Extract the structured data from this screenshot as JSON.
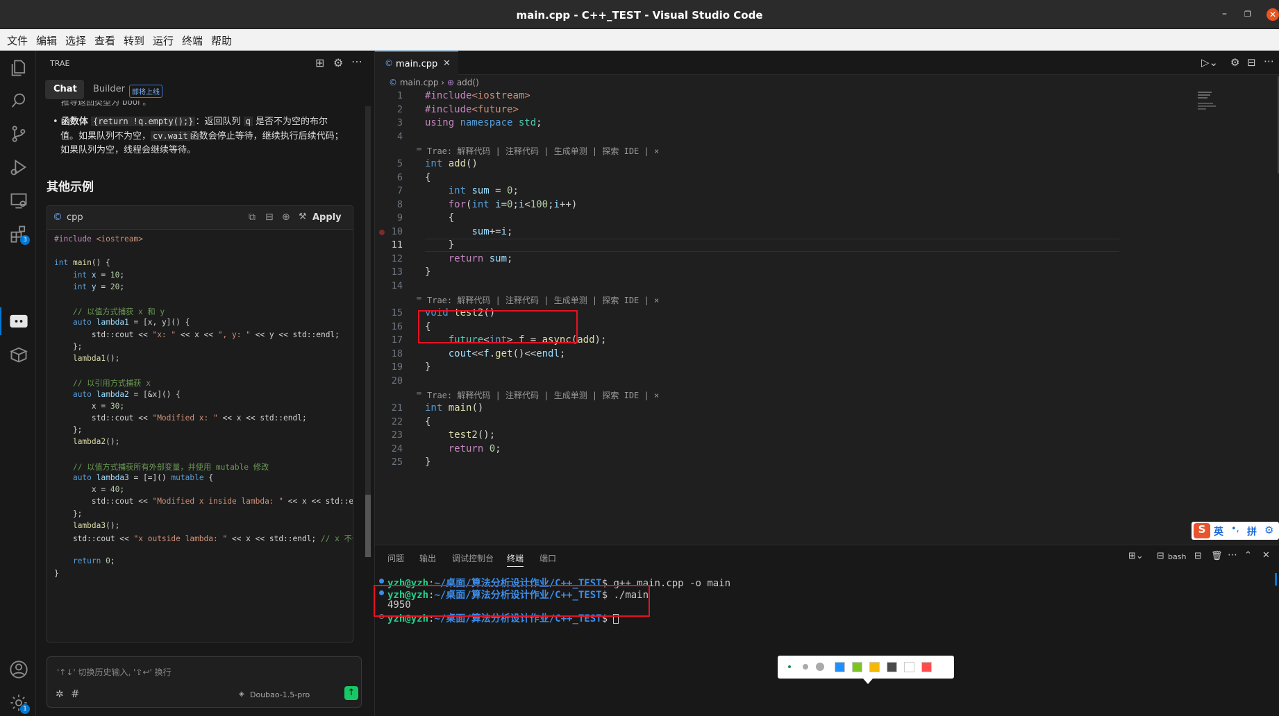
{
  "window": {
    "title": "main.cpp - C++_TEST - Visual Studio Code",
    "minimize": "–",
    "restore": "❐",
    "close": "✕"
  },
  "menu": [
    "文件",
    "编辑",
    "选择",
    "查看",
    "转到",
    "运行",
    "终端",
    "帮助"
  ],
  "activity": [
    {
      "icon": "files-icon"
    },
    {
      "icon": "search-icon"
    },
    {
      "icon": "source-control-icon"
    },
    {
      "icon": "run-debug-icon"
    },
    {
      "icon": "remote-explorer-icon"
    },
    {
      "icon": "extensions-icon",
      "badge": "3"
    },
    {
      "icon": "trae-chat-icon"
    },
    {
      "icon": "package-icon"
    },
    {
      "icon": "account-icon"
    },
    {
      "icon": "settings-gear-icon",
      "badge": "1"
    }
  ],
  "sidebar": {
    "title": "TRAE",
    "tab_chat": "Chat",
    "tab_builder": "Builder",
    "builder_badge": "即将上线",
    "cut_line": "推导返回类型为 bool 。",
    "bullet_label": "函数体",
    "bullet_code": "{return !q.empty();}",
    "bullet_text_a": "：返回队列",
    "bullet_q": "q",
    "bullet_text_b": "是否不为空的布尔",
    "bullet_line2a": "值。如果队列不为空，",
    "bullet_cvwait": "cv.wait",
    "bullet_line2b": "函数会停止等待，继续执行后续代码；",
    "bullet_line3": "如果队列为空，线程会继续等待。",
    "heading": "其他示例",
    "code_lang": "cpp",
    "apply": "Apply",
    "input_placeholder": "'↑↓' 切换历史输入, '⇧↩' 换行",
    "model": "Doubao-1.5-pro"
  },
  "sidebar_code": [
    [
      [
        "pp",
        "#include "
      ],
      [
        "inc",
        "<iostream>"
      ]
    ],
    [],
    [
      [
        "kw",
        "int "
      ],
      [
        "fn",
        "main"
      ],
      [
        "",
        "() {"
      ]
    ],
    [
      [
        "",
        "    "
      ],
      [
        "kw",
        "int "
      ],
      [
        "id",
        "x"
      ],
      [
        "",
        " = "
      ],
      [
        "num",
        "10"
      ],
      [
        "",
        ";"
      ]
    ],
    [
      [
        "",
        "    "
      ],
      [
        "kw",
        "int "
      ],
      [
        "id",
        "y"
      ],
      [
        "",
        " = "
      ],
      [
        "num",
        "20"
      ],
      [
        "",
        ";"
      ]
    ],
    [],
    [
      [
        "",
        "    "
      ],
      [
        "cmt",
        "// 以值方式捕获 x 和 y"
      ]
    ],
    [
      [
        "",
        "    "
      ],
      [
        "kw",
        "auto "
      ],
      [
        "id",
        "lambda1"
      ],
      [
        "",
        " = [x, y]() {"
      ]
    ],
    [
      [
        "",
        "        std::cout << "
      ],
      [
        "str",
        "\"x: \""
      ],
      [
        "",
        " << x << "
      ],
      [
        "str",
        "\", y: \""
      ],
      [
        "",
        " << y << std::endl;"
      ]
    ],
    [
      [
        "",
        "    };"
      ]
    ],
    [
      [
        "",
        "    "
      ],
      [
        "fn",
        "lambda1"
      ],
      [
        "",
        "();"
      ]
    ],
    [],
    [
      [
        "",
        "    "
      ],
      [
        "cmt",
        "// 以引用方式捕获 x"
      ]
    ],
    [
      [
        "",
        "    "
      ],
      [
        "kw",
        "auto "
      ],
      [
        "id",
        "lambda2"
      ],
      [
        "",
        " = [&x]() {"
      ]
    ],
    [
      [
        "",
        "        x = "
      ],
      [
        "num",
        "30"
      ],
      [
        "",
        ";"
      ]
    ],
    [
      [
        "",
        "        std::cout << "
      ],
      [
        "str",
        "\"Modified x: \""
      ],
      [
        "",
        " << x << std::endl;"
      ]
    ],
    [
      [
        "",
        "    };"
      ]
    ],
    [
      [
        "",
        "    "
      ],
      [
        "fn",
        "lambda2"
      ],
      [
        "",
        "();"
      ]
    ],
    [],
    [
      [
        "",
        "    "
      ],
      [
        "cmt",
        "// 以值方式捕获所有外部变量，并使用 mutable 修改"
      ]
    ],
    [
      [
        "",
        "    "
      ],
      [
        "kw",
        "auto "
      ],
      [
        "id",
        "lambda3"
      ],
      [
        "",
        " = [=]() "
      ],
      [
        "kw",
        "mutable"
      ],
      [
        "",
        " {"
      ]
    ],
    [
      [
        "",
        "        x = "
      ],
      [
        "num",
        "40"
      ],
      [
        "",
        ";"
      ]
    ],
    [
      [
        "",
        "        std::cout << "
      ],
      [
        "str",
        "\"Modified x inside lambda: \""
      ],
      [
        "",
        " << x << std::endl;"
      ]
    ],
    [
      [
        "",
        "    };"
      ]
    ],
    [
      [
        "",
        "    "
      ],
      [
        "fn",
        "lambda3"
      ],
      [
        "",
        "();"
      ]
    ],
    [
      [
        "",
        "    std::cout << "
      ],
      [
        "str",
        "\"x outside lambda: \""
      ],
      [
        "",
        " << x << std::endl; "
      ],
      [
        "cmt",
        "// x 不会"
      ]
    ],
    [],
    [
      [
        "",
        "    "
      ],
      [
        "kw",
        "return "
      ],
      [
        "num",
        "0"
      ],
      [
        "",
        ";"
      ]
    ],
    [
      [
        "",
        "}"
      ]
    ]
  ],
  "editor": {
    "tab": "main.cpp",
    "breadcrumb_file": "main.cpp",
    "breadcrumb_symbol": "add()",
    "lens": "Trae: 解释代码 | 注释代码 | 生成单测 | 探索 IDE | ×",
    "lines": [
      {
        "n": "1",
        "t": [
          [
            "pp",
            "#include"
          ],
          [
            "inc",
            "<iostream>"
          ]
        ]
      },
      {
        "n": "2",
        "t": [
          [
            "pp",
            "#include"
          ],
          [
            "inc",
            "<future>"
          ]
        ]
      },
      {
        "n": "3",
        "t": [
          [
            "pp",
            "using "
          ],
          [
            "kw",
            "namespace "
          ],
          [
            "ty",
            "std"
          ],
          [
            "",
            ";"
          ]
        ]
      },
      {
        "n": "4",
        "t": []
      },
      {
        "n": "5",
        "lens": true,
        "t": [
          [
            "kw",
            "int "
          ],
          [
            "fn",
            "add"
          ],
          [
            "",
            "()"
          ]
        ]
      },
      {
        "n": "6",
        "t": [
          [
            "",
            "{"
          ]
        ]
      },
      {
        "n": "7",
        "t": [
          [
            "",
            "    "
          ],
          [
            "kw",
            "int "
          ],
          [
            "id",
            "sum"
          ],
          [
            "",
            " = "
          ],
          [
            "num",
            "0"
          ],
          [
            "",
            ";"
          ]
        ]
      },
      {
        "n": "8",
        "t": [
          [
            "",
            "    "
          ],
          [
            "pp",
            "for"
          ],
          [
            "",
            "("
          ],
          [
            "kw",
            "int "
          ],
          [
            "id",
            "i"
          ],
          [
            "",
            "="
          ],
          [
            "num",
            "0"
          ],
          [
            "",
            ";"
          ],
          [
            "id",
            "i"
          ],
          [
            "",
            "<"
          ],
          [
            "num",
            "100"
          ],
          [
            "",
            ";"
          ],
          [
            "id",
            "i"
          ],
          [
            "",
            "++)"
          ]
        ]
      },
      {
        "n": "9",
        "t": [
          [
            "",
            "    {"
          ]
        ]
      },
      {
        "n": "10",
        "bp": true,
        "t": [
          [
            "",
            "        "
          ],
          [
            "id",
            "sum"
          ],
          [
            "",
            "+="
          ],
          [
            "id",
            "i"
          ],
          [
            "",
            ";"
          ]
        ]
      },
      {
        "n": "11",
        "cur": true,
        "t": [
          [
            "",
            "    }"
          ]
        ]
      },
      {
        "n": "12",
        "t": [
          [
            "",
            "    "
          ],
          [
            "pp",
            "return "
          ],
          [
            "id",
            "sum"
          ],
          [
            "",
            ";"
          ]
        ]
      },
      {
        "n": "13",
        "t": [
          [
            "",
            "}"
          ]
        ]
      },
      {
        "n": "14",
        "t": []
      },
      {
        "n": "15",
        "lens": true,
        "t": [
          [
            "kw",
            "void "
          ],
          [
            "fn",
            "test2"
          ],
          [
            "",
            "()"
          ]
        ]
      },
      {
        "n": "16",
        "t": [
          [
            "",
            "{"
          ]
        ]
      },
      {
        "n": "17",
        "t": [
          [
            "",
            "    "
          ],
          [
            "ty",
            "future"
          ],
          [
            "",
            "<"
          ],
          [
            "kw",
            "int"
          ],
          [
            "",
            "> "
          ],
          [
            "id",
            "f"
          ],
          [
            "",
            " = "
          ],
          [
            "fn",
            "async"
          ],
          [
            "",
            "("
          ],
          [
            "fn",
            "add"
          ],
          [
            "",
            ");"
          ]
        ]
      },
      {
        "n": "18",
        "t": [
          [
            "",
            "    "
          ],
          [
            "id",
            "cout"
          ],
          [
            "",
            "<<"
          ],
          [
            "id",
            "f"
          ],
          [
            "",
            "."
          ],
          [
            "fn",
            "get"
          ],
          [
            "",
            "()<<"
          ],
          [
            "id",
            "endl"
          ],
          [
            "",
            ";"
          ]
        ]
      },
      {
        "n": "19",
        "t": [
          [
            "",
            "}"
          ]
        ]
      },
      {
        "n": "20",
        "t": []
      },
      {
        "n": "21",
        "lens": true,
        "t": [
          [
            "kw",
            "int "
          ],
          [
            "fn",
            "main"
          ],
          [
            "",
            "()"
          ]
        ]
      },
      {
        "n": "22",
        "t": [
          [
            "",
            "{"
          ]
        ]
      },
      {
        "n": "23",
        "t": [
          [
            "",
            "    "
          ],
          [
            "fn",
            "test2"
          ],
          [
            "",
            "();"
          ]
        ]
      },
      {
        "n": "24",
        "t": [
          [
            "",
            "    "
          ],
          [
            "pp",
            "return "
          ],
          [
            "num",
            "0"
          ],
          [
            "",
            ";"
          ]
        ]
      },
      {
        "n": "25",
        "t": [
          [
            "",
            "}"
          ]
        ]
      }
    ]
  },
  "ime": {
    "lang": "英",
    "sep": "•,",
    "mode": "拼",
    "gear": "⚙"
  },
  "panel": {
    "tabs": [
      "问题",
      "输出",
      "调试控制台",
      "终端",
      "端口"
    ],
    "active": "终端",
    "shell": "bash",
    "terminal": [
      {
        "dot": "blue",
        "prompt": "yzh@yzh",
        "path": "~/桌面/算法分析设计作业/C++_TEST",
        "cmd": "$ g++ main.cpp -o main"
      },
      {
        "dot": "blue",
        "prompt": "yzh@yzh",
        "path": "~/桌面/算法分析设计作业/C++_TEST",
        "cmd": "$ ./main"
      },
      {
        "output": "4950"
      },
      {
        "dot": "hollow",
        "prompt": "yzh@yzh",
        "path": "~/桌面/算法分析设计作业/C++_TEST",
        "cmd": "$ ",
        "cursor": true
      }
    ]
  },
  "colors": {
    "swatches": [
      "#1e90ff",
      "#7cc520",
      "#f5b800",
      "#4a4a4a",
      "#ffffff",
      "#ff4d4d"
    ]
  }
}
